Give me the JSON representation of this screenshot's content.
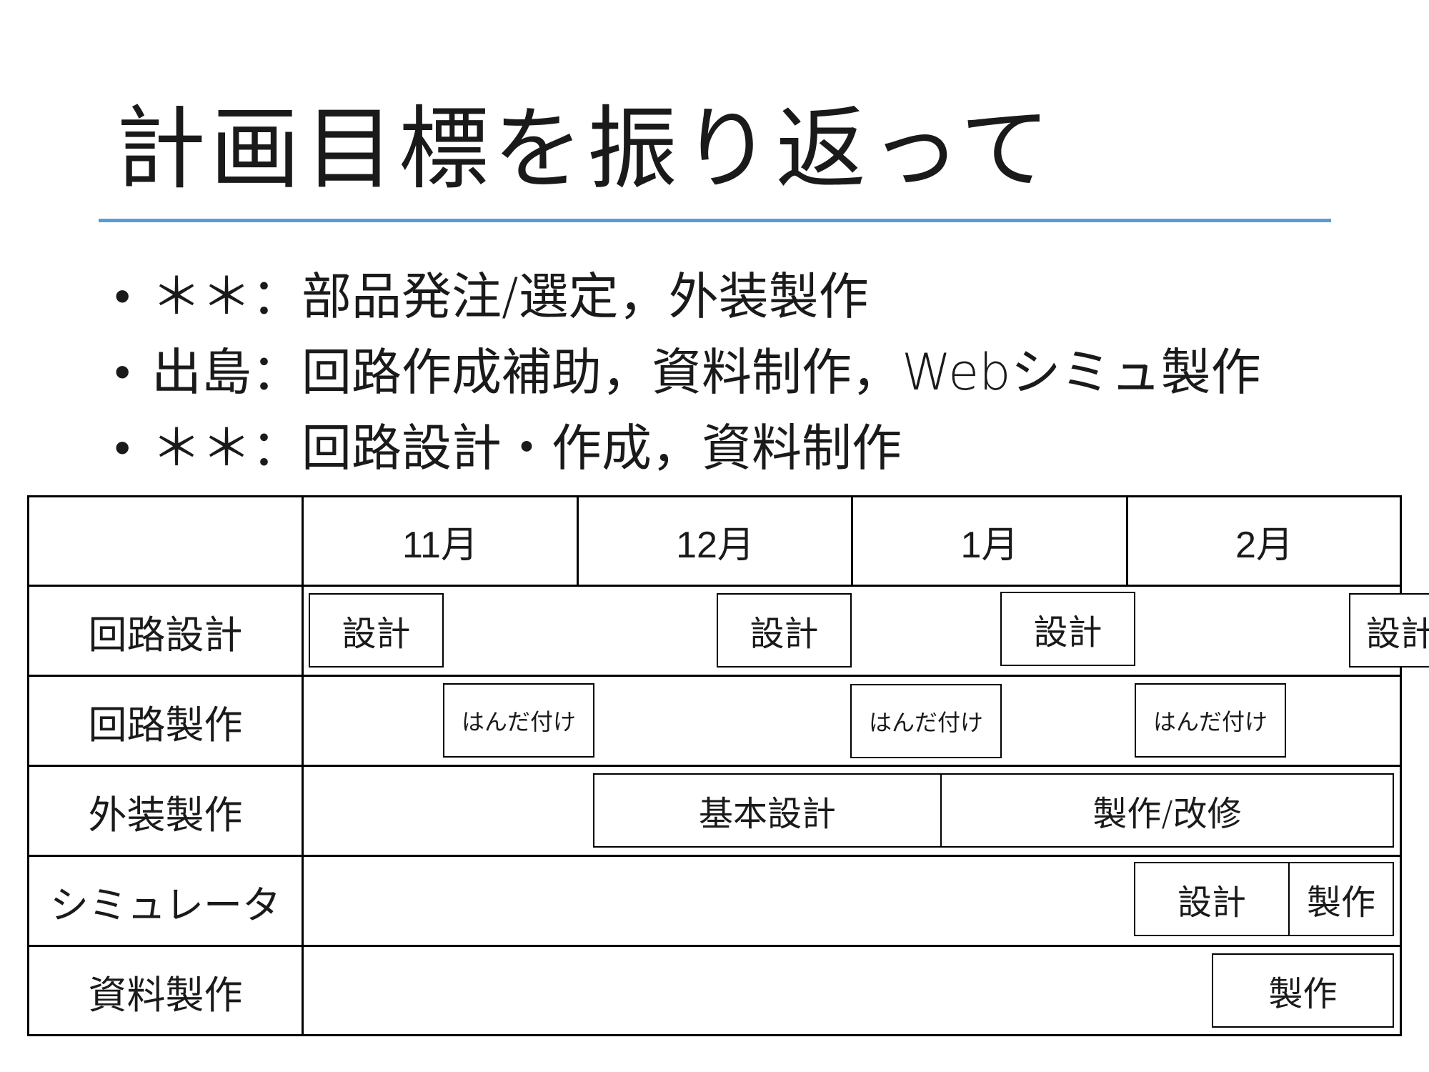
{
  "title": "計画目標を振り返って",
  "bullets": [
    {
      "name": "＊＊",
      "sep": "：",
      "text": "部品発注/選定，外装製作"
    },
    {
      "name": "出島",
      "sep": "：",
      "text": "回路作成補助，資料制作，Webシミュ製作"
    },
    {
      "name": "＊＊",
      "sep": "：",
      "text": "回路設計・作成，資料制作"
    }
  ],
  "schedule": {
    "months": [
      "11月",
      "12月",
      "1月",
      "2月"
    ],
    "rows": [
      {
        "label": "回路設計",
        "tasks": [
          "設計",
          "設計",
          "設計",
          "設計"
        ]
      },
      {
        "label": "回路製作",
        "tasks": [
          "はんだ付け",
          "はんだ付け",
          "はんだ付け"
        ]
      },
      {
        "label": "外装製作",
        "tasks": [
          "基本設計",
          "製作/改修"
        ]
      },
      {
        "label": "シミュレータ",
        "tasks": [
          "設計",
          "製作"
        ]
      },
      {
        "label": "資料製作",
        "tasks": [
          "製作"
        ]
      }
    ]
  }
}
